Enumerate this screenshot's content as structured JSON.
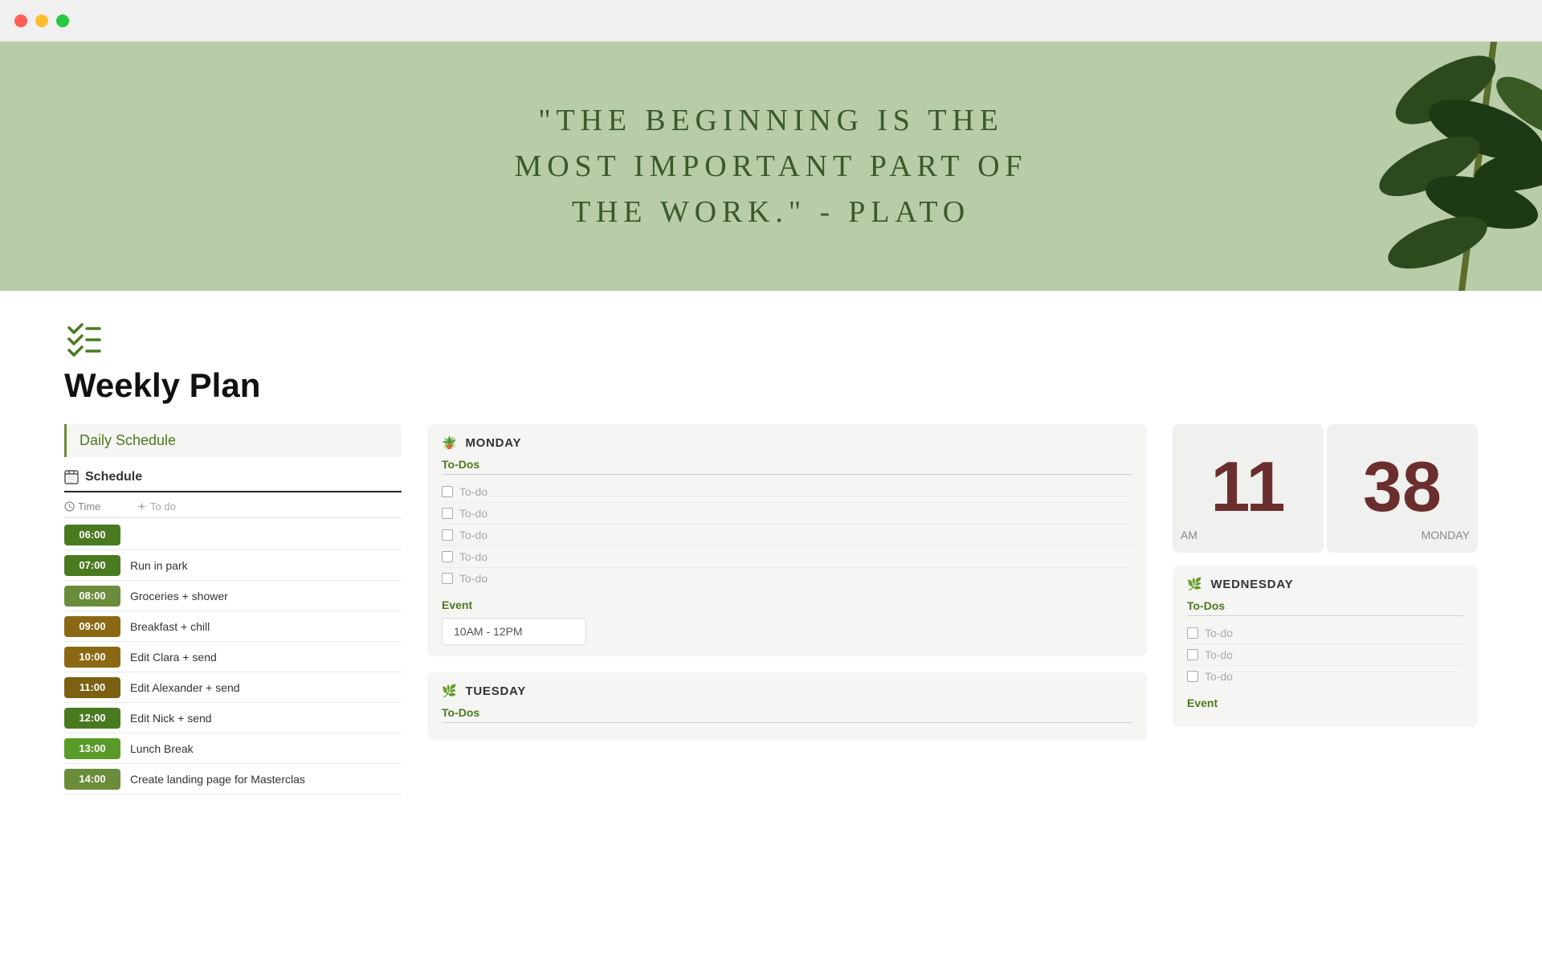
{
  "window": {
    "traffic_lights": [
      "red",
      "yellow",
      "green"
    ]
  },
  "hero": {
    "quote": "\"The Beginning is the Most Important Part of the Work.\" - Plato"
  },
  "page": {
    "icon": "✅",
    "title": "Weekly Plan"
  },
  "sidebar": {
    "daily_schedule_label": "Daily Schedule",
    "schedule_section": "Schedule",
    "col_time": "Time",
    "col_todo": "To do"
  },
  "schedule_rows": [
    {
      "time": "06:00",
      "color": "#4a7a20",
      "task": ""
    },
    {
      "time": "07:00",
      "color": "#4a7a20",
      "task": "Run in park"
    },
    {
      "time": "08:00",
      "color": "#6b8c3a",
      "task": "Groceries + shower"
    },
    {
      "time": "09:00",
      "color": "#8b6914",
      "task": "Breakfast + chill"
    },
    {
      "time": "10:00",
      "color": "#8b6914",
      "task": "Edit Clara + send"
    },
    {
      "time": "11:00",
      "color": "#7a6010",
      "task": "Edit Alexander + send"
    },
    {
      "time": "12:00",
      "color": "#4a7a20",
      "task": "Edit Nick + send"
    },
    {
      "time": "13:00",
      "color": "#5a9a28",
      "task": "Lunch Break"
    },
    {
      "time": "14:00",
      "color": "#6b8c3a",
      "task": "Create landing page for Masterclas"
    }
  ],
  "monday": {
    "icon": "🪴",
    "label": "MONDAY",
    "todos_label": "To-Dos",
    "todos": [
      "To-do",
      "To-do",
      "To-do",
      "To-do",
      "To-do"
    ],
    "event_label": "Event",
    "event_time": "10AM - 12PM"
  },
  "tuesday": {
    "icon": "🌿",
    "label": "TUESDAY",
    "todos_label": "To-Dos"
  },
  "clock": {
    "hours": "11",
    "minutes": "38",
    "am_pm": "AM",
    "day": "MONDAY"
  },
  "wednesday": {
    "icon": "🌿",
    "label": "WEDNESDAY",
    "todos_label": "To-Dos",
    "todos": [
      "To-do",
      "To-do",
      "To-do"
    ],
    "event_label": "Event"
  }
}
